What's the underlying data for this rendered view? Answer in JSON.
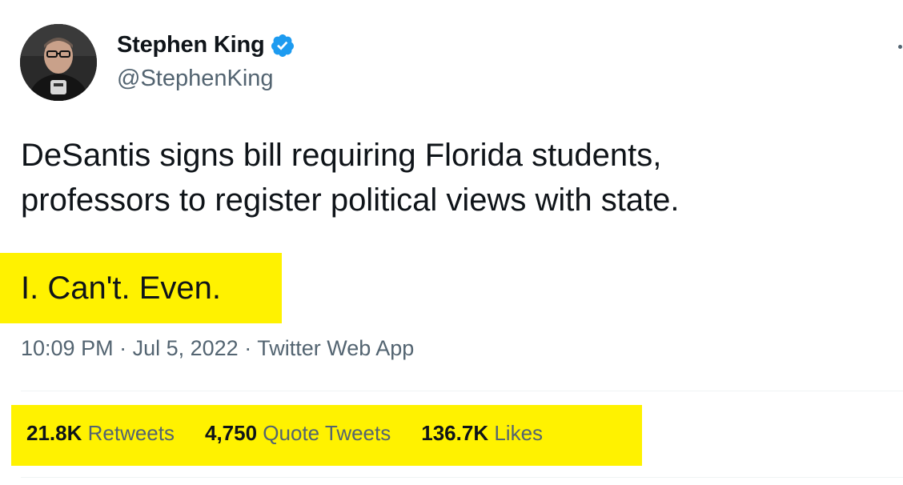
{
  "tweet": {
    "author": {
      "name": "Stephen King",
      "handle": "@StephenKing",
      "verified": true,
      "avatar_icon": "profile-photo",
      "verified_icon": "verified-badge-icon",
      "verified_color": "#1d9bf0"
    },
    "text_lines": [
      "DeSantis signs bill requiring Florida students,",
      "professors to register political views with state."
    ],
    "highlighted_text": "I. Can't. Even.",
    "timestamp": {
      "time": "10:09 PM",
      "separator": " · ",
      "date": "Jul 5, 2022",
      "source": "Twitter Web App"
    },
    "stats": [
      {
        "count": "21.8K",
        "label": "Retweets"
      },
      {
        "count": "4,750",
        "label": "Quote Tweets"
      },
      {
        "count": "136.7K",
        "label": "Likes"
      }
    ]
  },
  "colors": {
    "highlight": "#fff200",
    "primary_text": "#0f1419",
    "secondary_text": "#536471"
  }
}
